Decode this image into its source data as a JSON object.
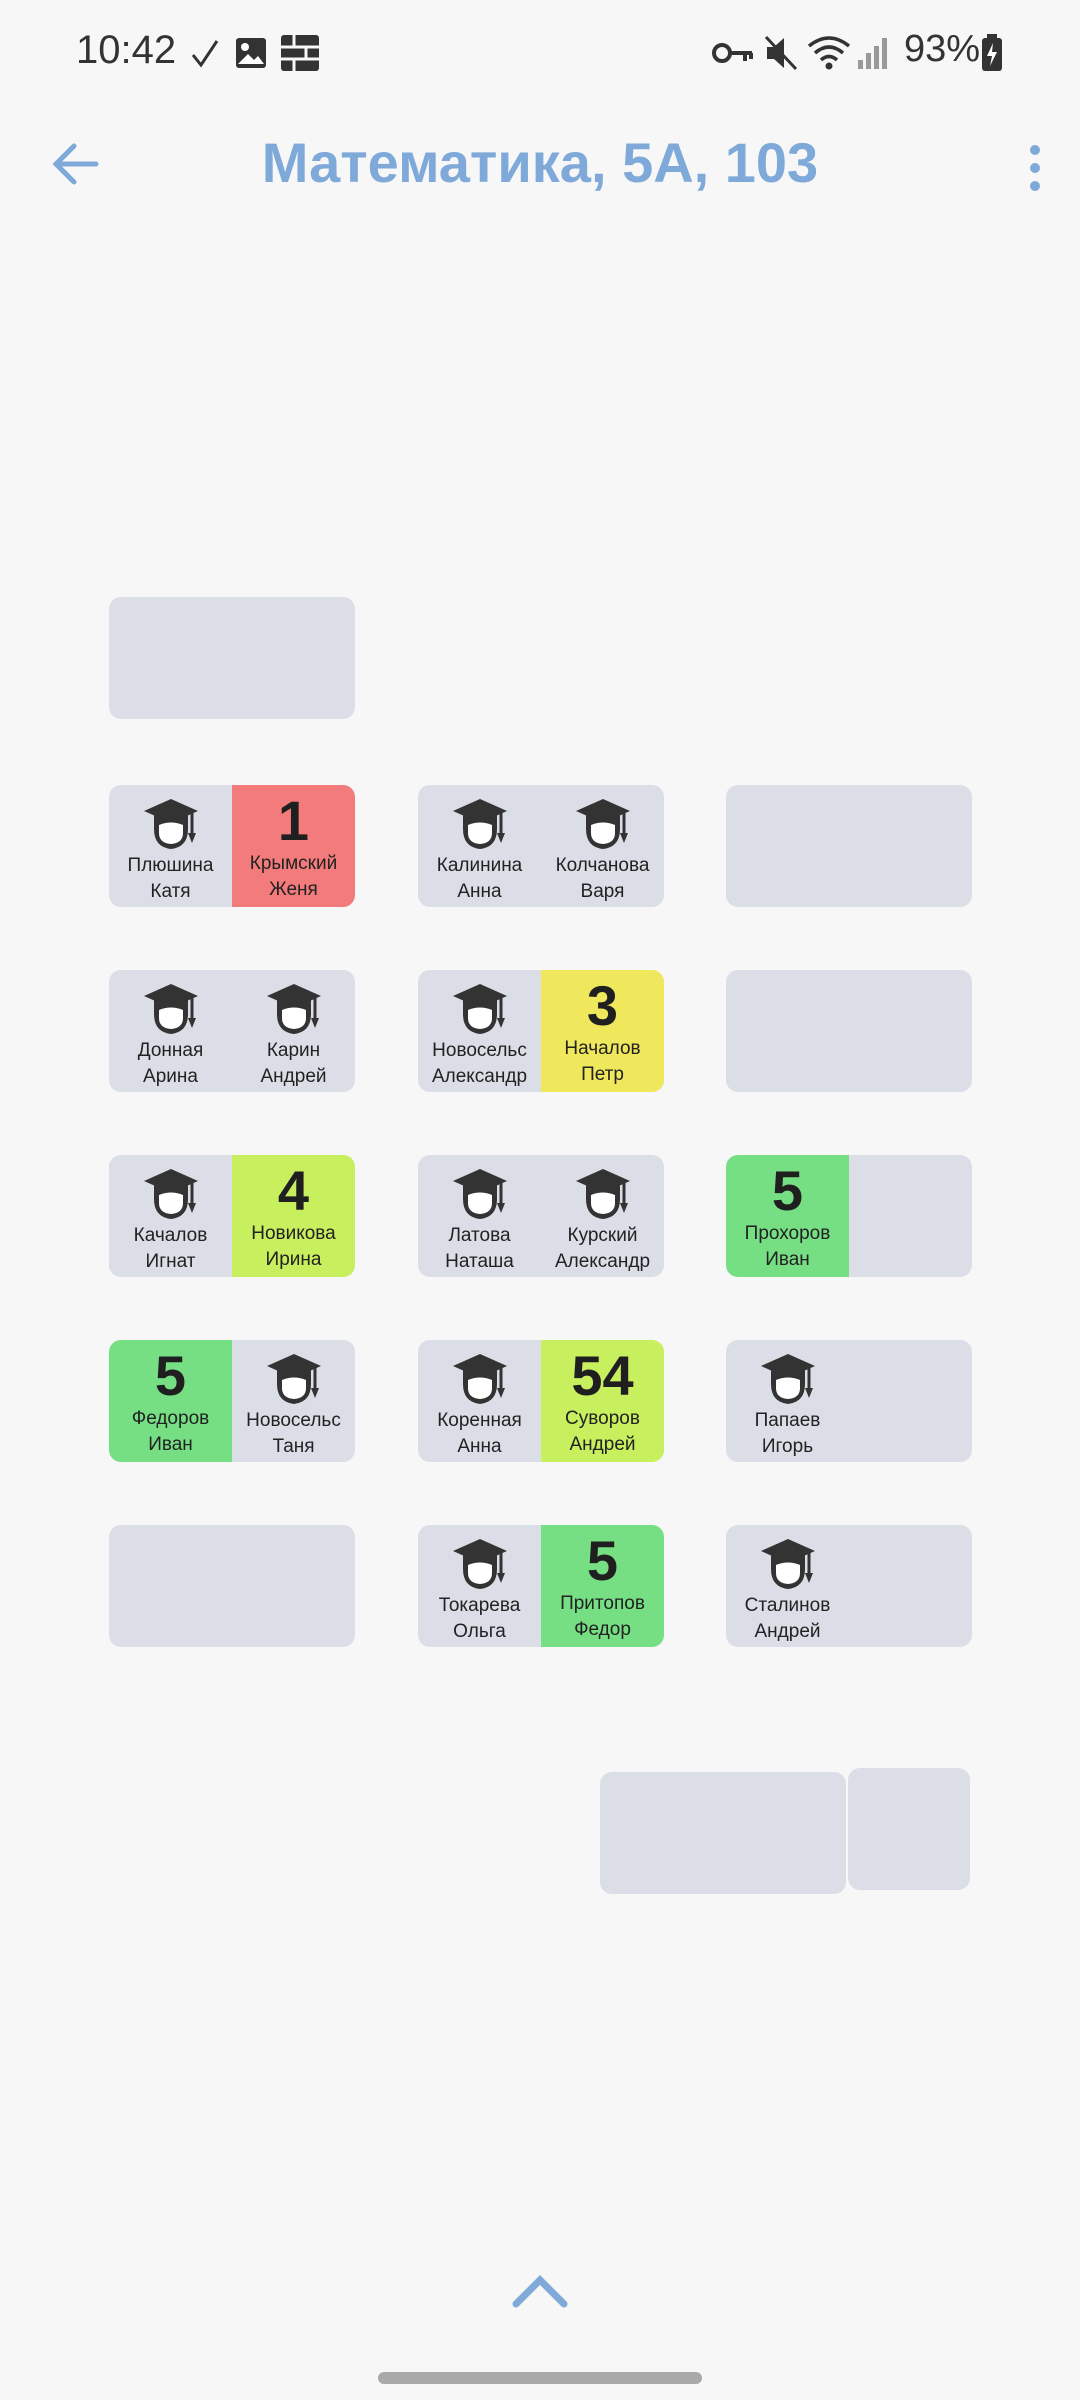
{
  "status": {
    "time": "10:42",
    "battery": "93%",
    "icons": [
      "check-icon",
      "image-icon",
      "grid-app-icon",
      "key-icon",
      "mute-icon",
      "wifi-icon",
      "signal-icon",
      "battery-icon"
    ]
  },
  "appbar": {
    "title": "Математика, 5А, 103"
  },
  "desks": [
    {
      "left": {
        "grade": "1",
        "first": "Крымский",
        "last": "Женя",
        "style": "g1"
      },
      "right": null
    },
    {
      "left": {
        "first": "Плюшина",
        "last": "Катя"
      },
      "right": {
        "grade": "1",
        "first": "Крымский",
        "last": "Женя",
        "style": "g1"
      }
    },
    {
      "left": {
        "first": "Калинина",
        "last": "Анна"
      },
      "right": {
        "first": "Колчанова",
        "last": "Варя"
      }
    },
    {
      "left": {
        "first": "Донная",
        "last": "Арина"
      },
      "right": {
        "first": "Карин",
        "last": "Андрей"
      }
    },
    {
      "left": {
        "first": "Новосельс",
        "last": "Александр"
      },
      "right": {
        "grade": "3",
        "first": "Началов",
        "last": "Петр",
        "style": "g3"
      }
    },
    {
      "left": {
        "first": "Качалов",
        "last": "Игнат"
      },
      "right": {
        "grade": "4",
        "first": "Новикова",
        "last": "Ирина",
        "style": "g4"
      }
    },
    {
      "left": {
        "first": "Латова",
        "last": "Наташа"
      },
      "right": {
        "first": "Курский",
        "last": "Александр"
      }
    },
    {
      "left": {
        "grade": "5",
        "first": "Прохоров",
        "last": "Иван",
        "style": "g5"
      },
      "right": null
    },
    {
      "left": {
        "grade": "5",
        "first": "Федоров",
        "last": "Иван",
        "style": "g5"
      },
      "right": {
        "first": "Новосельс",
        "last": "Таня"
      }
    },
    {
      "left": {
        "first": "Коренная",
        "last": "Анна"
      },
      "right": {
        "grade": "54",
        "first": "Суворов",
        "last": "Андрей",
        "style": "g54"
      }
    },
    {
      "left": {
        "first": "Папаев",
        "last": "Игорь"
      },
      "right": null
    },
    {
      "left": {
        "first": "Токарева",
        "last": "Ольга"
      },
      "right": {
        "grade": "5",
        "first": "Притопов",
        "last": "Федор",
        "style": "g5"
      }
    },
    {
      "left": {
        "first": "Сталинов",
        "last": "Андрей"
      },
      "right": null
    }
  ]
}
